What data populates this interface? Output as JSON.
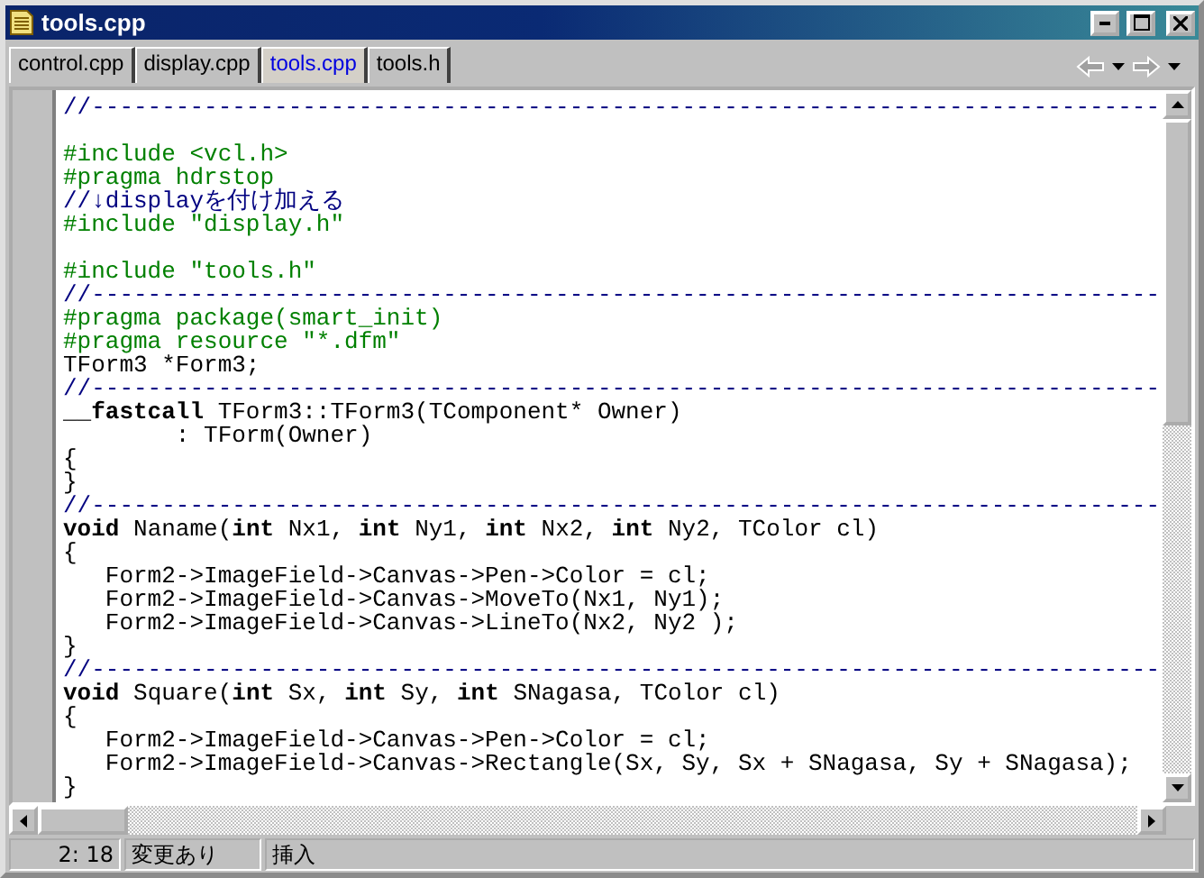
{
  "window": {
    "title": "tools.cpp"
  },
  "tabs": [
    {
      "label": "control.cpp",
      "selected": false
    },
    {
      "label": "display.cpp",
      "selected": false
    },
    {
      "label": "tools.cpp",
      "selected": true
    },
    {
      "label": "tools.h",
      "selected": false
    }
  ],
  "lines": [
    {
      "kind": "code",
      "segments": [
        {
          "kind": "comment",
          "text": "//----------------------------------------------------------------------------"
        }
      ]
    },
    {
      "kind": "blank"
    },
    {
      "kind": "code",
      "segments": [
        {
          "kind": "directive",
          "text": "#include <vcl.h>"
        }
      ]
    },
    {
      "kind": "code",
      "segments": [
        {
          "kind": "directive",
          "text": "#pragma hdrstop"
        }
      ]
    },
    {
      "kind": "code",
      "segments": [
        {
          "kind": "comment",
          "text": "//↓displayを付け加える"
        }
      ]
    },
    {
      "kind": "code",
      "segments": [
        {
          "kind": "directive",
          "text": "#include \"display.h\""
        }
      ]
    },
    {
      "kind": "blank"
    },
    {
      "kind": "code",
      "segments": [
        {
          "kind": "directive",
          "text": "#include \"tools.h\""
        }
      ]
    },
    {
      "kind": "code",
      "segments": [
        {
          "kind": "comment",
          "text": "//----------------------------------------------------------------------------"
        }
      ]
    },
    {
      "kind": "code",
      "segments": [
        {
          "kind": "directive",
          "text": "#pragma package(smart_init)"
        }
      ]
    },
    {
      "kind": "code",
      "segments": [
        {
          "kind": "directive",
          "text": "#pragma resource \"*.dfm\""
        }
      ]
    },
    {
      "kind": "code",
      "segments": [
        {
          "kind": "plain",
          "text": "TForm3 *Form3;"
        }
      ]
    },
    {
      "kind": "code",
      "segments": [
        {
          "kind": "comment",
          "text": "//----------------------------------------------------------------------------"
        }
      ]
    },
    {
      "kind": "code",
      "segments": [
        {
          "kind": "keyword",
          "text": "__fastcall"
        },
        {
          "kind": "plain",
          "text": " TForm3::TForm3(TComponent* Owner)"
        }
      ]
    },
    {
      "kind": "code",
      "segments": [
        {
          "kind": "plain",
          "text": "        : TForm(Owner)"
        }
      ]
    },
    {
      "kind": "code",
      "segments": [
        {
          "kind": "plain",
          "text": "{"
        }
      ]
    },
    {
      "kind": "code",
      "segments": [
        {
          "kind": "plain",
          "text": "}"
        }
      ]
    },
    {
      "kind": "code",
      "segments": [
        {
          "kind": "comment",
          "text": "//----------------------------------------------------------------------------"
        }
      ]
    },
    {
      "kind": "code",
      "segments": [
        {
          "kind": "keyword",
          "text": "void"
        },
        {
          "kind": "plain",
          "text": " Naname("
        },
        {
          "kind": "keyword",
          "text": "int"
        },
        {
          "kind": "plain",
          "text": " Nx1, "
        },
        {
          "kind": "keyword",
          "text": "int"
        },
        {
          "kind": "plain",
          "text": " Ny1, "
        },
        {
          "kind": "keyword",
          "text": "int"
        },
        {
          "kind": "plain",
          "text": " Nx2, "
        },
        {
          "kind": "keyword",
          "text": "int"
        },
        {
          "kind": "plain",
          "text": " Ny2, TColor cl)"
        }
      ]
    },
    {
      "kind": "code",
      "segments": [
        {
          "kind": "plain",
          "text": "{"
        }
      ]
    },
    {
      "kind": "code",
      "segments": [
        {
          "kind": "plain",
          "text": "   Form2->ImageField->Canvas->Pen->Color = cl;"
        }
      ]
    },
    {
      "kind": "code",
      "segments": [
        {
          "kind": "plain",
          "text": "   Form2->ImageField->Canvas->MoveTo(Nx1, Ny1);"
        }
      ]
    },
    {
      "kind": "code",
      "segments": [
        {
          "kind": "plain",
          "text": "   Form2->ImageField->Canvas->LineTo(Nx2, Ny2 );"
        }
      ]
    },
    {
      "kind": "code",
      "segments": [
        {
          "kind": "plain",
          "text": "}"
        }
      ]
    },
    {
      "kind": "code",
      "segments": [
        {
          "kind": "comment",
          "text": "//----------------------------------------------------------------------------"
        }
      ]
    },
    {
      "kind": "code",
      "segments": [
        {
          "kind": "keyword",
          "text": "void"
        },
        {
          "kind": "plain",
          "text": " Square("
        },
        {
          "kind": "keyword",
          "text": "int"
        },
        {
          "kind": "plain",
          "text": " Sx, "
        },
        {
          "kind": "keyword",
          "text": "int"
        },
        {
          "kind": "plain",
          "text": " Sy, "
        },
        {
          "kind": "keyword",
          "text": "int"
        },
        {
          "kind": "plain",
          "text": " SNagasa, TColor cl)"
        }
      ]
    },
    {
      "kind": "code",
      "segments": [
        {
          "kind": "plain",
          "text": "{"
        }
      ]
    },
    {
      "kind": "code",
      "segments": [
        {
          "kind": "plain",
          "text": "   Form2->ImageField->Canvas->Pen->Color = cl;"
        }
      ]
    },
    {
      "kind": "code",
      "segments": [
        {
          "kind": "plain",
          "text": "   Form2->ImageField->Canvas->Rectangle(Sx, Sy, Sx + SNagasa, Sy + SNagasa);"
        }
      ]
    },
    {
      "kind": "code",
      "segments": [
        {
          "kind": "plain",
          "text": "}"
        }
      ]
    }
  ],
  "status_bar": {
    "position": "2: 18",
    "modified": "変更あり",
    "mode": "挿入"
  }
}
